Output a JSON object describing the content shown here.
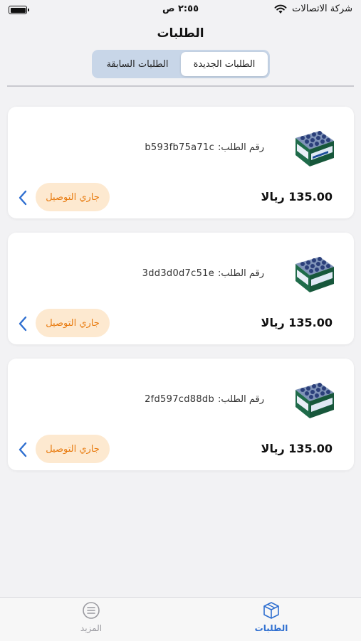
{
  "status_bar": {
    "carrier": "شركة الاتصالات",
    "time": "٢:٥٥ ص"
  },
  "header": {
    "title": "الطلبات"
  },
  "segments": {
    "new": "الطلبات الجديدة",
    "previous": "الطلبات السابقة",
    "active": "new"
  },
  "orders": [
    {
      "order_label": "رقم الطلب:",
      "order_id": "b593fb75a71c",
      "price": "135.00 ريالا",
      "status": "جاري التوصيل"
    },
    {
      "order_label": "رقم الطلب:",
      "order_id": "3dd3d0d7c51e",
      "price": "135.00 ريالا",
      "status": "جاري التوصيل"
    },
    {
      "order_label": "رقم الطلب:",
      "order_id": "2fd597cd88db",
      "price": "135.00 ريالا",
      "status": "جاري التوصيل"
    }
  ],
  "tab_bar": {
    "orders_label": "الطلبات",
    "more_label": "المزيد",
    "active_color": "#2f6fd0",
    "inactive_color": "#9a9aa0"
  },
  "colors": {
    "status_bg": "#fde9d0",
    "status_text": "#e87a0e",
    "chevron": "#2f6fd0",
    "segment_bg": "#c8d6e8"
  },
  "icons": [
    "wifi-icon",
    "battery-icon",
    "water-pack-icon",
    "chevron-left-icon",
    "box-icon",
    "menu-circle-icon"
  ]
}
